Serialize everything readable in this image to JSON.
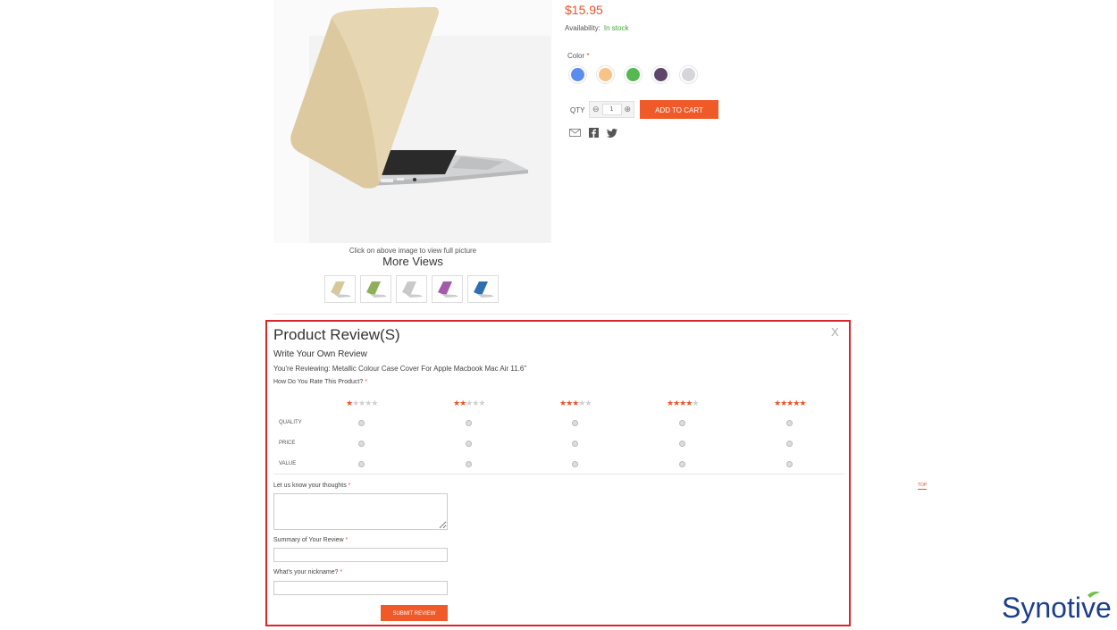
{
  "product": {
    "price": "$15.95",
    "availability_label": "Availability:",
    "availability_value": "In stock",
    "color_label": "Color",
    "required_mark": "*",
    "swatches": [
      {
        "name": "blue",
        "color": "#5b8def"
      },
      {
        "name": "peach",
        "color": "#f7c387"
      },
      {
        "name": "green",
        "color": "#55b94f"
      },
      {
        "name": "purple",
        "color": "#5e4668"
      },
      {
        "name": "silver",
        "color": "#d4d6da"
      }
    ],
    "qty_label": "QTY",
    "qty_value": "1",
    "add_to_cart": "ADD TO CART",
    "share_icons": [
      "email-icon",
      "facebook-icon",
      "twitter-icon"
    ]
  },
  "gallery": {
    "caption": "Click on above image to view full picture",
    "more_views": "More Views",
    "thumbnails": [
      {
        "name": "gold",
        "color": "#d8c79a"
      },
      {
        "name": "green",
        "color": "#8fae5a"
      },
      {
        "name": "silver",
        "color": "#c9c9c9"
      },
      {
        "name": "purple",
        "color": "#a35aa8"
      },
      {
        "name": "blue",
        "color": "#2f6fb0"
      }
    ]
  },
  "review": {
    "title": "Product Review(S)",
    "close": "X",
    "write_title": "Write Your Own Review",
    "reviewing": "You're Reviewing: Metallic Colour Case Cover For Apple Macbook Mac Air 11.6''",
    "rate_question": "How Do You Rate This Product?",
    "required_mark": "*",
    "star_levels": [
      1,
      2,
      3,
      4,
      5
    ],
    "rows": [
      "QUALITY",
      "PRICE",
      "VALUE"
    ],
    "thoughts_label": "Let us know your thoughts",
    "summary_label": "Summary of Your Review",
    "nickname_label": "What's your nickname?",
    "submit": "SUBMIT REVIEW",
    "border_color": "#d9262c"
  },
  "top_link": "TOP",
  "logo": {
    "text": "Synotive",
    "color": "#1b3f8b",
    "accent": "#6cc24a"
  }
}
